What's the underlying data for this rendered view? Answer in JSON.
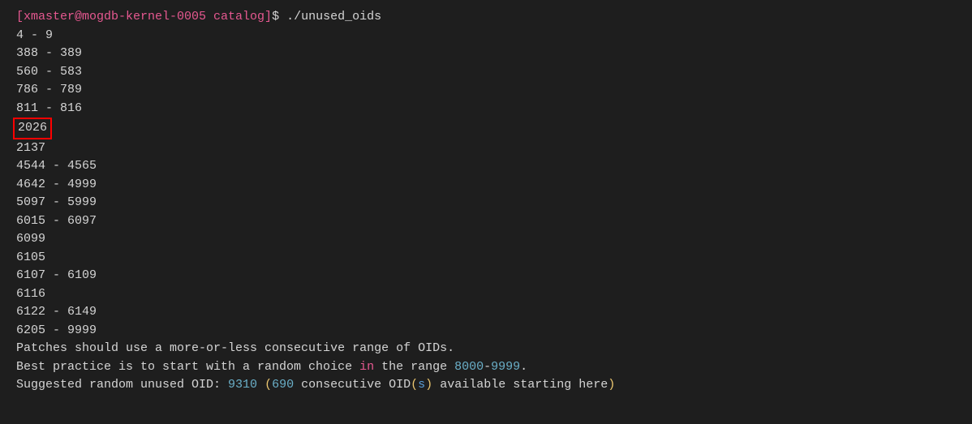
{
  "prompt": {
    "prefix": "[xmaster@mogdb-kernel-0005 catalog]",
    "sep": "$ ",
    "command": "./unused_oids"
  },
  "lines": [
    "4 - 9",
    "388 - 389",
    "560 - 583",
    "786 - 789",
    "811 - 816",
    "2026",
    "2137",
    "4544 - 4565",
    "4642 - 4999",
    "5097 - 5999",
    "6015 - 6097",
    "6099",
    "6105",
    "6107 - 6109",
    "6116",
    "6122 - 6149",
    "6205 - 9999"
  ],
  "highlight_index": 5,
  "footer": {
    "line1": "Patches should use a more-or-less consecutive range of OIDs.",
    "line2_a": "Best practice is to start with a random choice ",
    "line2_in": "in",
    "line2_b": " the range ",
    "line2_range1": "8000",
    "line2_dash": "-",
    "line2_range2": "9999",
    "line2_dot": ".",
    "line3_a": "Suggested random unused OID: ",
    "line3_oid": "9310",
    "line3_sp": " ",
    "line3_p1": "(",
    "line3_count": "690",
    "line3_mid": " consecutive OID",
    "line3_p2": "(",
    "line3_s": "s",
    "line3_p3": ")",
    "line3_end": " available starting here",
    "line3_p4": ")"
  }
}
